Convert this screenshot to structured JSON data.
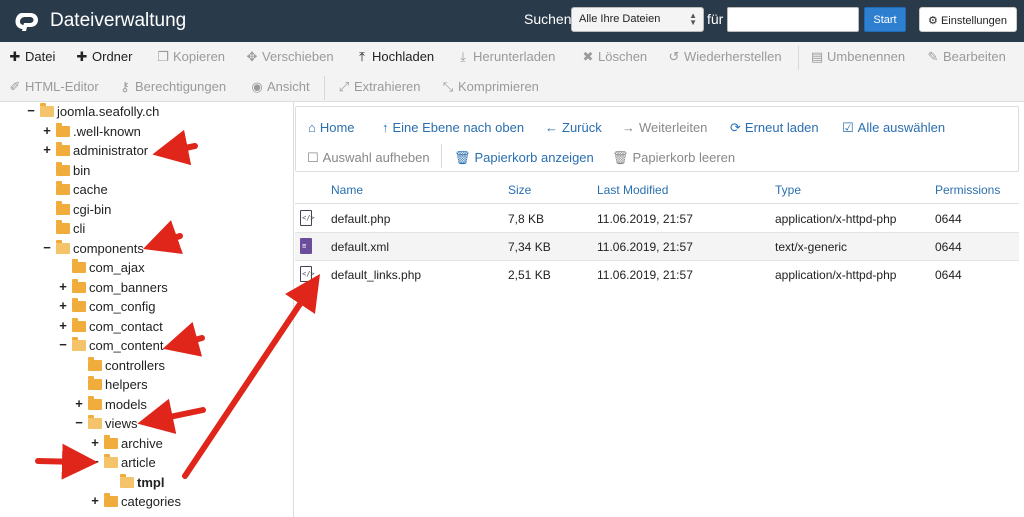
{
  "header": {
    "title": "Dateiverwaltung",
    "search_label": "Suchen",
    "search_scope": "Alle Ihre Dateien",
    "for_label": "für",
    "search_value": "",
    "start_label": "Start",
    "settings_label": "Einstellungen"
  },
  "toolbar": {
    "row1": [
      {
        "icon": "plus-icon",
        "label": "Datei",
        "enabled": true
      },
      {
        "icon": "plus-icon",
        "label": "Ordner",
        "enabled": true
      },
      {
        "icon": "copy-icon",
        "label": "Kopieren",
        "enabled": false
      },
      {
        "icon": "move-icon",
        "label": "Verschieben",
        "enabled": false
      },
      {
        "icon": "upload-icon",
        "label": "Hochladen",
        "enabled": true
      },
      {
        "icon": "download-icon",
        "label": "Herunterladen",
        "enabled": false
      },
      {
        "icon": "delete-icon",
        "label": "Löschen",
        "enabled": false
      },
      {
        "icon": "restore-icon",
        "label": "Wiederherstellen",
        "enabled": false
      },
      {
        "icon": "rename-icon",
        "label": "Umbenennen",
        "enabled": false
      },
      {
        "icon": "edit-icon",
        "label": "Bearbeiten",
        "enabled": false
      }
    ],
    "row2": [
      {
        "icon": "html-editor-icon",
        "label": "HTML-Editor",
        "enabled": false
      },
      {
        "icon": "key-icon",
        "label": "Berechtigungen",
        "enabled": false
      },
      {
        "icon": "eye-icon",
        "label": "Ansicht",
        "enabled": false
      },
      {
        "icon": "extract-icon",
        "label": "Extrahieren",
        "enabled": false
      },
      {
        "icon": "compress-icon",
        "label": "Komprimieren",
        "enabled": false
      }
    ]
  },
  "tree": [
    {
      "toggle": "−",
      "label": "joomla.seafolly.ch",
      "open": true
    },
    {
      "toggle": "+",
      "label": ".well-known",
      "open": false
    },
    {
      "toggle": "+",
      "label": "administrator",
      "open": false
    },
    {
      "toggle": "",
      "label": "bin",
      "open": false
    },
    {
      "toggle": "",
      "label": "cache",
      "open": false
    },
    {
      "toggle": "",
      "label": "cgi-bin",
      "open": false
    },
    {
      "toggle": "",
      "label": "cli",
      "open": false
    },
    {
      "toggle": "−",
      "label": "components",
      "open": true
    },
    {
      "toggle": "",
      "label": "com_ajax",
      "open": false
    },
    {
      "toggle": "+",
      "label": "com_banners",
      "open": false
    },
    {
      "toggle": "+",
      "label": "com_config",
      "open": false
    },
    {
      "toggle": "+",
      "label": "com_contact",
      "open": false
    },
    {
      "toggle": "−",
      "label": "com_content",
      "open": true
    },
    {
      "toggle": "",
      "label": "controllers",
      "open": false
    },
    {
      "toggle": "",
      "label": "helpers",
      "open": false
    },
    {
      "toggle": "+",
      "label": "models",
      "open": false
    },
    {
      "toggle": "−",
      "label": "views",
      "open": true
    },
    {
      "toggle": "+",
      "label": "archive",
      "open": false
    },
    {
      "toggle": "−",
      "label": "article",
      "open": true
    },
    {
      "toggle": "",
      "label": "tmpl",
      "open": true,
      "bold": true
    },
    {
      "toggle": "+",
      "label": "categories",
      "open": false
    }
  ],
  "nav": {
    "home": "Home",
    "up": "Eine Ebene nach oben",
    "back": "Zurück",
    "forward": "Weiterleiten",
    "reload": "Erneut laden",
    "select_all": "Alle auswählen",
    "deselect": "Auswahl aufheben",
    "show_trash": "Papierkorb anzeigen",
    "empty_trash": "Papierkorb leeren"
  },
  "table": {
    "columns": [
      "Name",
      "Size",
      "Last Modified",
      "Type",
      "Permissions"
    ],
    "rows": [
      {
        "icon": "php-file-icon",
        "name": "default.php",
        "size": "7,8 KB",
        "modified": "11.06.2019, 21:57",
        "type": "application/x-httpd-php",
        "perm": "0644"
      },
      {
        "icon": "xml-file-icon",
        "name": "default.xml",
        "size": "7,34 KB",
        "modified": "11.06.2019, 21:57",
        "type": "text/x-generic",
        "perm": "0644"
      },
      {
        "icon": "php-file-icon",
        "name": "default_links.php",
        "size": "2,51 KB",
        "modified": "11.06.2019, 21:57",
        "type": "application/x-httpd-php",
        "perm": "0644"
      }
    ]
  },
  "colors": {
    "header_bg": "#293a4a",
    "link": "#2a6fb0",
    "start_button": "#2f7fd0",
    "folder": "#f0ad3c",
    "annotation_arrow": "#e0261b"
  }
}
